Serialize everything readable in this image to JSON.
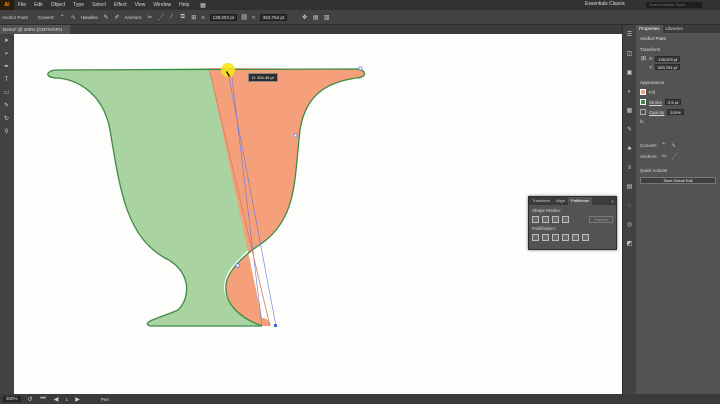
{
  "app": {
    "logo": "Ai",
    "workspace": "Essentials Classic",
    "search_placeholder": "Search Adobe Stock"
  },
  "menu": [
    "File",
    "Edit",
    "Object",
    "Type",
    "Select",
    "Effect",
    "View",
    "Window",
    "Help"
  ],
  "control": {
    "mode": "Anchor Point",
    "convert": "Convert:",
    "handles": "Handles:",
    "anchors": "Anchors:",
    "x": "138,003 pt",
    "y": "353,764 pt"
  },
  "doc_tab": {
    "label": "Demo* @ 300% (CMYK/GPU Preview)",
    "close": "×"
  },
  "properties": {
    "tabs": [
      "Properties",
      "Libraries"
    ],
    "anchor_point": "Anchor Point",
    "transform": "Transform",
    "x": "138,003 pt",
    "y": "353,764 pt",
    "appearance": "Appearance",
    "fill": "Fill",
    "stroke": "Stroke",
    "stroke_value": "0,5 pt",
    "opacity": "Opacity",
    "opacity_value": "100%",
    "fx": "fx.",
    "convert": "Convert:",
    "anchors": "Anchors:",
    "quick_actions": "Quick Actions",
    "start_global_edit": "Start Global Edit"
  },
  "pathfinder": {
    "tabs": [
      "Transform",
      "Align",
      "Pathfinder"
    ],
    "shape_modes": "Shape Modes:",
    "expand": "Expand",
    "pathfinders": "Pathfinders:"
  },
  "status": {
    "zoom": "300%",
    "page": "1",
    "tool": "Pen"
  },
  "tooltip": "D: 324,45 pt",
  "colors": {
    "green_fill": "#a9d4a2",
    "orange_fill": "#f5a07a",
    "outline": "#3c8c45",
    "highlight": "#f7e318"
  }
}
